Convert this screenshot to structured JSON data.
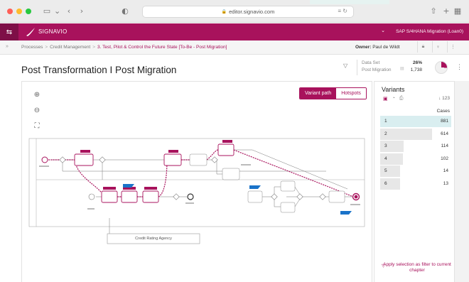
{
  "browser": {
    "url": "editor.signavio.com",
    "reader_icon": "≡",
    "reload_icon": "↻"
  },
  "header": {
    "brand": "SIGNAVIO",
    "workspace": "SAP S/4HANA Migration (Loan0)"
  },
  "breadcrumb": {
    "items": [
      "Processes",
      "Credit Management"
    ],
    "current": "3. Test, Pilot & Control the Future State [To-Be - Post Migration]",
    "owner_label": "Owner:",
    "owner_name": "Paul de Wildt"
  },
  "page": {
    "title": "Post Transformation I Post Migration",
    "dataset_label": "Data Set",
    "dataset_name": "Post Migration",
    "percent": "26%",
    "count": "1,738",
    "percent_value": 0.26
  },
  "canvas": {
    "toggle_active": "Variant path",
    "toggle_inactive": "Hotspots",
    "zoom_in_icon": "zoom-in-icon",
    "zoom_out_icon": "zoom-out-icon",
    "fit_icon": "fit-icon",
    "external_label": "Credit Rating Agency",
    "sap_badge": "SAP"
  },
  "variants": {
    "title": "Variants",
    "sort_label": "↓",
    "sort_value": "123",
    "cases_label": "Cases",
    "max": 881,
    "rows": [
      {
        "num": "1",
        "value": "881",
        "v": 881
      },
      {
        "num": "2",
        "value": "614",
        "v": 614
      },
      {
        "num": "3",
        "value": "114",
        "v": 114
      },
      {
        "num": "4",
        "value": "102",
        "v": 102
      },
      {
        "num": "5",
        "value": "14",
        "v": 14
      },
      {
        "num": "6",
        "value": "13",
        "v": 13
      }
    ],
    "apply_text": "Apply selection as filter to current chapter"
  },
  "colors": {
    "brand": "#a8125c",
    "selected_row": "#d9eef0",
    "bar_fill": "#e7e7e7"
  }
}
